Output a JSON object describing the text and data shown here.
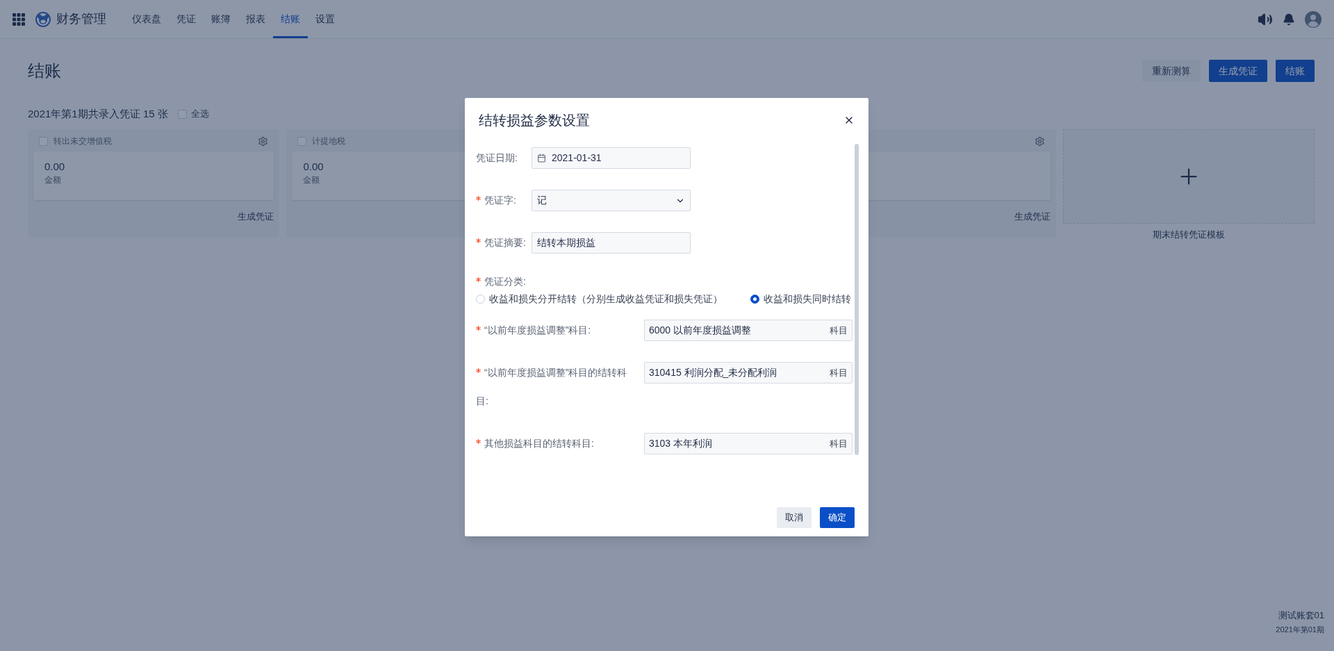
{
  "app": {
    "title": "财务管理"
  },
  "nav": [
    {
      "label": "仪表盘",
      "selected": false
    },
    {
      "label": "凭证",
      "selected": false
    },
    {
      "label": "账簿",
      "selected": false
    },
    {
      "label": "报表",
      "selected": false
    },
    {
      "label": "结账",
      "selected": true
    },
    {
      "label": "设置",
      "selected": false
    }
  ],
  "page": {
    "title": "结账",
    "actions": [
      {
        "label": "重新测算",
        "kind": "secondary"
      },
      {
        "label": "生成凭证",
        "kind": "primary"
      },
      {
        "label": "结账",
        "kind": "primary"
      }
    ]
  },
  "summary": {
    "text": "2021年第1期共录入凭证 15 张",
    "select_all": {
      "label": "全选",
      "checked": false
    }
  },
  "cards": [
    {
      "title": "转出未交增值税",
      "checked": false,
      "amount": "0.00",
      "amount_label": "金额",
      "action": "生成凭证"
    },
    {
      "title": "计提地税",
      "checked": false,
      "amount": "0.00",
      "amount_label": "金额"
    },
    {
      "action": "生成凭证"
    }
  ],
  "add_card": {
    "label": "期末结转凭证模板"
  },
  "footer": {
    "account": "测试账套01",
    "period": "2021年第01期"
  },
  "dialog": {
    "title": "结转损益参数设置",
    "fields": [
      {
        "kind": "date",
        "label": "凭证日期:",
        "required": false,
        "value": "2021-01-31"
      },
      {
        "kind": "select",
        "label": "凭证字:",
        "required": true,
        "value": "记"
      },
      {
        "kind": "text",
        "label": "凭证摘要:",
        "required": true,
        "value": "结转本期损益"
      },
      {
        "kind": "radio",
        "label": "凭证分类:",
        "required": true,
        "options": [
          {
            "label": "收益和损失分开结转（分别生成收益凭证和损失凭证）",
            "selected": false
          },
          {
            "label": "收益和损失同时结转",
            "selected": true
          }
        ]
      },
      {
        "kind": "subject",
        "label": "“以前年度损益调整”科目:",
        "required": true,
        "value": "6000 以前年度损益调整",
        "suffix": "科目"
      },
      {
        "kind": "subject",
        "label": "“以前年度损益调整”科目的结转科目:",
        "required": true,
        "value": "310415 利润分配_未分配利润",
        "suffix": "科目"
      },
      {
        "kind": "subject",
        "label": "其他损益科目的结转科目:",
        "required": true,
        "value": "3103 本年利润",
        "suffix": "科目"
      }
    ],
    "buttons": [
      {
        "label": "取消",
        "kind": "secondary"
      },
      {
        "label": "确定",
        "kind": "primary"
      }
    ]
  }
}
